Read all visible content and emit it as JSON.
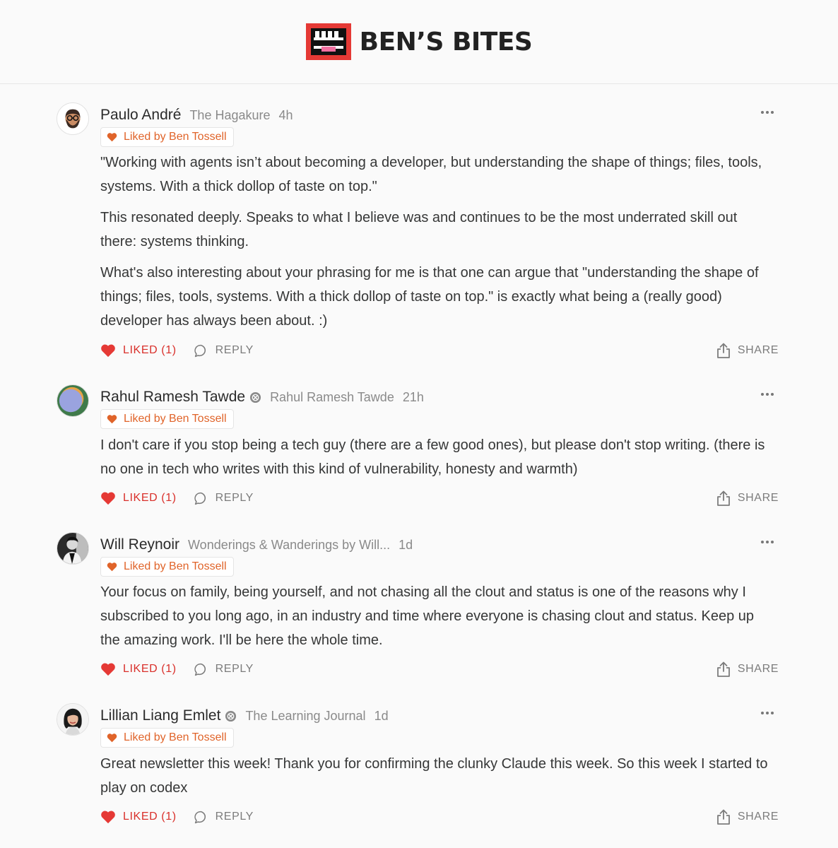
{
  "brand": {
    "name": "BEN’S BITES",
    "accent": "#e53935"
  },
  "liked_by_label": "Liked by Ben Tossell",
  "action_labels": {
    "liked": "LIKED (1)",
    "reply": "REPLY",
    "share": "SHARE"
  },
  "comments": [
    {
      "author": "Paulo André",
      "publication": "The Hagakure",
      "time": "4h",
      "verified": false,
      "paragraphs": [
        "\"Working with agents isn’t about becoming a developer, but understanding the shape of things; files, tools, systems. With a thick dollop of taste on top.\"",
        "This resonated deeply. Speaks to what I believe was and continues to be the most underrated skill out there: systems thinking.",
        "What's also interesting about your phrasing for me is that one can argue that \"understanding the shape of things; files, tools, systems. With a thick dollop of taste on top.\" is exactly what being a (really good) developer has always been about. :)"
      ]
    },
    {
      "author": "Rahul Ramesh Tawde",
      "publication": "Rahul Ramesh Tawde",
      "time": "21h",
      "verified": true,
      "paragraphs": [
        "I don't care if you stop being a tech guy (there are a few good ones), but please don't stop writing. (there is no one in tech who writes with this kind of vulnerability, honesty and warmth)"
      ]
    },
    {
      "author": "Will Reynoir",
      "publication": "Wonderings & Wanderings by Will...",
      "time": "1d",
      "verified": false,
      "paragraphs": [
        "Your focus on family, being yourself, and not chasing all the clout and status is one of the reasons why I subscribed to you long ago, in an industry and time where everyone is chasing clout and status. Keep up the amazing work. I'll be here the whole time."
      ]
    },
    {
      "author": "Lillian Liang Emlet",
      "publication": "The Learning Journal",
      "time": "1d",
      "verified": true,
      "paragraphs": [
        "Great newsletter this week! Thank you for confirming the clunky Claude this week. So this week I started to play on codex"
      ]
    }
  ]
}
